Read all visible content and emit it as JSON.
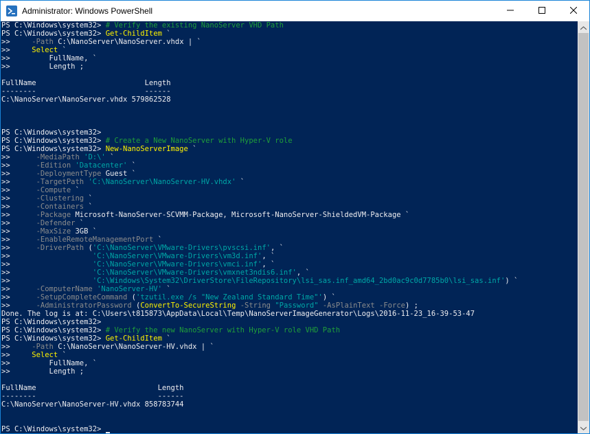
{
  "window": {
    "title": "Administrator: Windows PowerShell",
    "icon": "powershell-icon",
    "controls": [
      "minimize-icon",
      "maximize-icon",
      "close-icon"
    ]
  },
  "colors": {
    "console_bg": "#012456",
    "text": "#eeedf0",
    "comment": "#1f9f3a",
    "command": "#fff200",
    "parameter": "#8c8c8c",
    "string": "#00a7a7"
  },
  "console": {
    "lines": [
      [
        {
          "t": "PS C:\\Windows\\system32> ",
          "c": "p"
        },
        {
          "t": "# Verify the existing NanoServer VHD Path",
          "c": "c"
        }
      ],
      [
        {
          "t": "PS C:\\Windows\\system32> ",
          "c": "p"
        },
        {
          "t": "Get-ChildItem",
          "c": "y"
        },
        {
          "t": " `",
          "c": "w"
        }
      ],
      [
        {
          "t": ">>     ",
          "c": "p"
        },
        {
          "t": "-Path",
          "c": "g"
        },
        {
          "t": " C:\\NanoServer\\NanoServer.vhdx | `",
          "c": "w"
        }
      ],
      [
        {
          "t": ">>     ",
          "c": "p"
        },
        {
          "t": "Select",
          "c": "y"
        },
        {
          "t": " `",
          "c": "w"
        }
      ],
      [
        {
          "t": ">>         FullName, `",
          "c": "p"
        }
      ],
      [
        {
          "t": ">>         Length ;",
          "c": "p"
        }
      ],
      [],
      [
        {
          "t": "FullName                         Length",
          "c": "p"
        }
      ],
      [
        {
          "t": "--------                         ------",
          "c": "p"
        }
      ],
      [
        {
          "t": "C:\\NanoServer\\NanoServer.vhdx 579862528",
          "c": "p"
        }
      ],
      [],
      [],
      [],
      [
        {
          "t": "PS C:\\Windows\\system32>",
          "c": "p"
        }
      ],
      [
        {
          "t": "PS C:\\Windows\\system32> ",
          "c": "p"
        },
        {
          "t": "# Create a New NanoServer with Hyper-V role",
          "c": "c"
        }
      ],
      [
        {
          "t": "PS C:\\Windows\\system32> ",
          "c": "p"
        },
        {
          "t": "New-NanoServerImage",
          "c": "y"
        },
        {
          "t": " `",
          "c": "w"
        }
      ],
      [
        {
          "t": ">>      ",
          "c": "p"
        },
        {
          "t": "-MediaPath",
          "c": "g"
        },
        {
          "t": " ",
          "c": "w"
        },
        {
          "t": "'D:\\'",
          "c": "s"
        },
        {
          "t": " `",
          "c": "w"
        }
      ],
      [
        {
          "t": ">>      ",
          "c": "p"
        },
        {
          "t": "-Edition",
          "c": "g"
        },
        {
          "t": " ",
          "c": "w"
        },
        {
          "t": "'Datacenter'",
          "c": "s"
        },
        {
          "t": " `",
          "c": "w"
        }
      ],
      [
        {
          "t": ">>      ",
          "c": "p"
        },
        {
          "t": "-DeploymentType",
          "c": "g"
        },
        {
          "t": " Guest `",
          "c": "w"
        }
      ],
      [
        {
          "t": ">>      ",
          "c": "p"
        },
        {
          "t": "-TargetPath",
          "c": "g"
        },
        {
          "t": " ",
          "c": "w"
        },
        {
          "t": "'C:\\NanoServer\\NanoServer-HV.vhdx'",
          "c": "s"
        },
        {
          "t": " `",
          "c": "w"
        }
      ],
      [
        {
          "t": ">>      ",
          "c": "p"
        },
        {
          "t": "-Compute",
          "c": "g"
        },
        {
          "t": " `",
          "c": "w"
        }
      ],
      [
        {
          "t": ">>      ",
          "c": "p"
        },
        {
          "t": "-Clustering",
          "c": "g"
        },
        {
          "t": " `",
          "c": "w"
        }
      ],
      [
        {
          "t": ">>      ",
          "c": "p"
        },
        {
          "t": "-Containers",
          "c": "g"
        },
        {
          "t": " `",
          "c": "w"
        }
      ],
      [
        {
          "t": ">>      ",
          "c": "p"
        },
        {
          "t": "-Package",
          "c": "g"
        },
        {
          "t": " Microsoft-NanoServer-SCVMM-Package, Microsoft-NanoServer-ShieldedVM-Package `",
          "c": "w"
        }
      ],
      [
        {
          "t": ">>      ",
          "c": "p"
        },
        {
          "t": "-Defender",
          "c": "g"
        },
        {
          "t": " `",
          "c": "w"
        }
      ],
      [
        {
          "t": ">>      ",
          "c": "p"
        },
        {
          "t": "-MaxSize",
          "c": "g"
        },
        {
          "t": " 3GB `",
          "c": "w"
        }
      ],
      [
        {
          "t": ">>      ",
          "c": "p"
        },
        {
          "t": "-EnableRemoteManagementPort",
          "c": "g"
        },
        {
          "t": " `",
          "c": "w"
        }
      ],
      [
        {
          "t": ">>      ",
          "c": "p"
        },
        {
          "t": "-DriverPath",
          "c": "g"
        },
        {
          "t": " (",
          "c": "w"
        },
        {
          "t": "'C:\\NanoServer\\VMware-Drivers\\pvscsi.inf'",
          "c": "s"
        },
        {
          "t": ", `",
          "c": "w"
        }
      ],
      [
        {
          "t": ">>                   ",
          "c": "p"
        },
        {
          "t": "'C:\\NanoServer\\VMware-Drivers\\vm3d.inf'",
          "c": "s"
        },
        {
          "t": ", `",
          "c": "w"
        }
      ],
      [
        {
          "t": ">>                   ",
          "c": "p"
        },
        {
          "t": "'C:\\NanoServer\\VMware-Drivers\\vmci.inf'",
          "c": "s"
        },
        {
          "t": ", `",
          "c": "w"
        }
      ],
      [
        {
          "t": ">>                   ",
          "c": "p"
        },
        {
          "t": "'C:\\NanoServer\\VMware-Drivers\\vmxnet3ndis6.inf'",
          "c": "s"
        },
        {
          "t": ", `",
          "c": "w"
        }
      ],
      [
        {
          "t": ">>                   ",
          "c": "p"
        },
        {
          "t": "'C:\\Windows\\System32\\DriverStore\\FileRepository\\lsi_sas.inf_amd64_2bd0ac9c0d7785b0\\lsi_sas.inf'",
          "c": "s"
        },
        {
          "t": ") `",
          "c": "w"
        }
      ],
      [
        {
          "t": ">>      ",
          "c": "p"
        },
        {
          "t": "-ComputerName",
          "c": "g"
        },
        {
          "t": " ",
          "c": "w"
        },
        {
          "t": "'NanoServer-HV'",
          "c": "s"
        },
        {
          "t": " `",
          "c": "w"
        }
      ],
      [
        {
          "t": ">>      ",
          "c": "p"
        },
        {
          "t": "-SetupCompleteCommand",
          "c": "g"
        },
        {
          "t": " (",
          "c": "w"
        },
        {
          "t": "'tzutil.exe /s \"New Zealand Standard Time\"'",
          "c": "s"
        },
        {
          "t": ") `",
          "c": "w"
        }
      ],
      [
        {
          "t": ">>      ",
          "c": "p"
        },
        {
          "t": "-AdministratorPassword",
          "c": "g"
        },
        {
          "t": " (",
          "c": "w"
        },
        {
          "t": "ConvertTo-SecureString",
          "c": "y"
        },
        {
          "t": " ",
          "c": "w"
        },
        {
          "t": "-String",
          "c": "g"
        },
        {
          "t": " ",
          "c": "w"
        },
        {
          "t": "\"Password\"",
          "c": "s"
        },
        {
          "t": " ",
          "c": "w"
        },
        {
          "t": "-AsPlainText -Force",
          "c": "g"
        },
        {
          "t": ") ;",
          "c": "w"
        }
      ],
      [
        {
          "t": "Done. The log is at: C:\\Users\\t815873\\AppData\\Local\\Temp\\NanoServerImageGenerator\\Logs\\2016-11-23_16-39-53-47",
          "c": "p"
        }
      ],
      [
        {
          "t": "PS C:\\Windows\\system32>",
          "c": "p"
        }
      ],
      [
        {
          "t": "PS C:\\Windows\\system32> ",
          "c": "p"
        },
        {
          "t": "# Verify the new NanoServer with Hyper-V role VHD Path",
          "c": "c"
        }
      ],
      [
        {
          "t": "PS C:\\Windows\\system32> ",
          "c": "p"
        },
        {
          "t": "Get-ChildItem",
          "c": "y"
        },
        {
          "t": " `",
          "c": "w"
        }
      ],
      [
        {
          "t": ">>     ",
          "c": "p"
        },
        {
          "t": "-Path",
          "c": "g"
        },
        {
          "t": " C:\\NanoServer\\NanoServer-HV.vhdx | `",
          "c": "w"
        }
      ],
      [
        {
          "t": ">>     ",
          "c": "p"
        },
        {
          "t": "Select",
          "c": "y"
        },
        {
          "t": " `",
          "c": "w"
        }
      ],
      [
        {
          "t": ">>         FullName, `",
          "c": "p"
        }
      ],
      [
        {
          "t": ">>         Length ;",
          "c": "p"
        }
      ],
      [],
      [
        {
          "t": "FullName                            Length",
          "c": "p"
        }
      ],
      [
        {
          "t": "--------                            ------",
          "c": "p"
        }
      ],
      [
        {
          "t": "C:\\NanoServer\\NanoServer-HV.vhdx 858783744",
          "c": "p"
        }
      ],
      [],
      [],
      [
        {
          "t": "PS C:\\Windows\\system32> ",
          "c": "p"
        },
        {
          "t": "_cursor_",
          "c": "cursor"
        }
      ]
    ]
  }
}
